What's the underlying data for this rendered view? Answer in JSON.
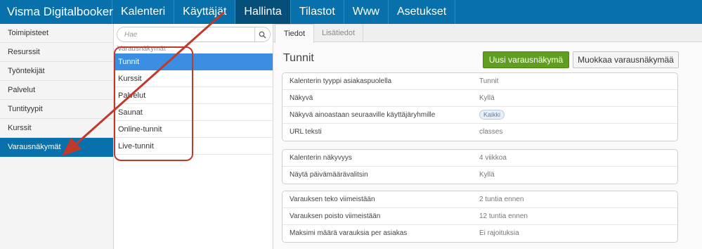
{
  "topbar": {
    "brand": "Visma Digitalbooker",
    "nav": [
      {
        "label": "Kalenteri"
      },
      {
        "label": "Käyttäjät"
      },
      {
        "label": "Hallinta"
      },
      {
        "label": "Tilastot"
      },
      {
        "label": "Www"
      },
      {
        "label": "Asetukset"
      }
    ]
  },
  "sidebar": {
    "items": [
      {
        "label": "Toimipisteet"
      },
      {
        "label": "Resurssit"
      },
      {
        "label": "Työntekijät"
      },
      {
        "label": "Palvelut"
      },
      {
        "label": "Tuntityypit"
      },
      {
        "label": "Kurssit"
      },
      {
        "label": "Varausnäkymät"
      }
    ]
  },
  "search": {
    "placeholder": "Hae",
    "icon": "search-icon"
  },
  "list": {
    "group_header": "Varausnäkymät",
    "items": [
      {
        "label": "Tunnit"
      },
      {
        "label": "Kurssit"
      },
      {
        "label": "Palvelut"
      },
      {
        "label": "Saunat"
      },
      {
        "label": "Online-tunnit"
      },
      {
        "label": "Live-tunnit"
      }
    ]
  },
  "detail": {
    "tabs": [
      {
        "label": "Tiedot"
      },
      {
        "label": "Lisätiedot"
      }
    ],
    "title": "Tunnit",
    "new_button": "Uusi varausnäkymä",
    "edit_button": "Muokkaa varausnäkymää",
    "card1": [
      {
        "key": "Kalenterin tyyppi asiakaspuolella",
        "value": "Tunnit"
      },
      {
        "key": "Näkyvä",
        "value": "Kyllä"
      },
      {
        "key": "Näkyvä ainoastaan seuraaville käyttäjäryhmille",
        "value": "Kaikki"
      },
      {
        "key": "URL teksti",
        "value": "classes"
      }
    ],
    "card2": [
      {
        "key": "Kalenterin näkyvyys",
        "value": "4 viikkoa"
      },
      {
        "key": "Näytä päivämäärävalitsin",
        "value": "Kyllä"
      }
    ],
    "card3": [
      {
        "key": "Varauksen teko viimeistään",
        "value": "2 tuntia ennen"
      },
      {
        "key": "Varauksen poisto viimeistään",
        "value": "12 tuntia ennen"
      },
      {
        "key": "Maksimi määrä varauksia per asiakas",
        "value": "Ei rajoituksia"
      }
    ]
  },
  "colors": {
    "topbar": "#0871ab",
    "active_nav": "#064f7a",
    "sidebar_active": "#0871ab",
    "list_active": "#3c8ee2",
    "primary_button": "#5f9e1f",
    "annotation": "#c0392b"
  }
}
